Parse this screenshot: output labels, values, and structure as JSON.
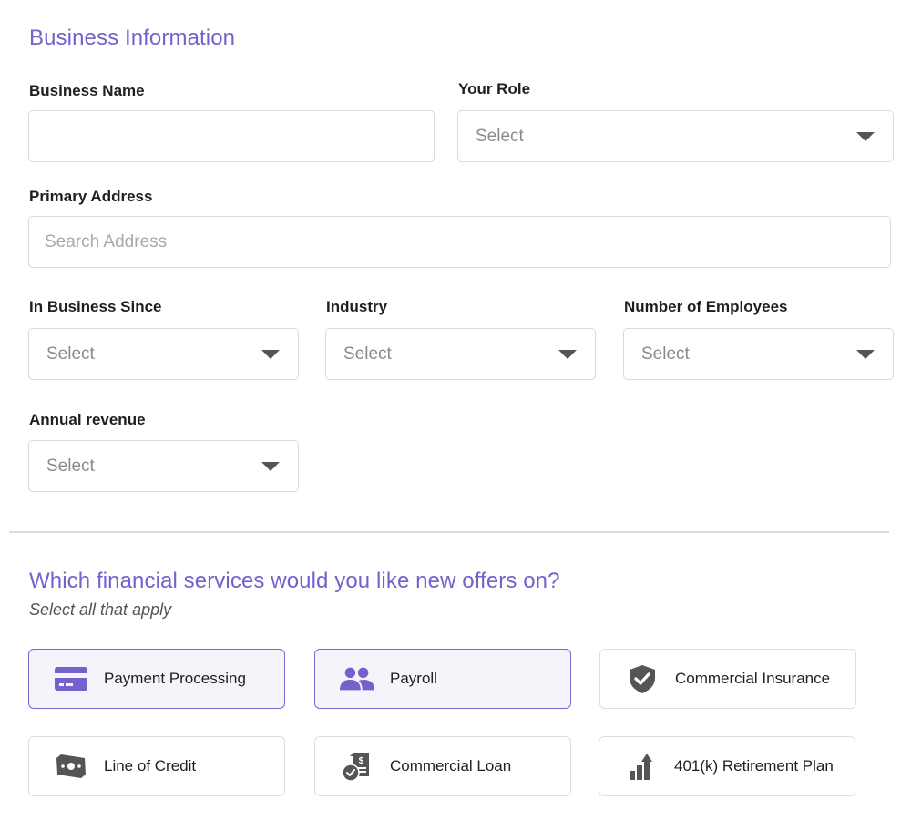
{
  "business_info": {
    "title": "Business Information",
    "business_name": {
      "label": "Business Name",
      "value": ""
    },
    "your_role": {
      "label": "Your Role",
      "value": "Select"
    },
    "primary_address": {
      "label": "Primary Address",
      "placeholder": "Search Address",
      "value": ""
    },
    "in_business_since": {
      "label": "In Business Since",
      "value": "Select"
    },
    "industry": {
      "label": "Industry",
      "value": "Select"
    },
    "number_of_employees": {
      "label": "Number of Employees",
      "value": "Select"
    },
    "annual_revenue": {
      "label": "Annual revenue",
      "value": "Select"
    }
  },
  "services": {
    "title": "Which financial services would you like new offers on?",
    "subtitle": "Select all that apply",
    "options": [
      {
        "label": "Payment Processing",
        "icon": "credit-card-icon",
        "selected": true
      },
      {
        "label": "Payroll",
        "icon": "people-icon",
        "selected": true
      },
      {
        "label": "Commercial Insurance",
        "icon": "shield-check-icon",
        "selected": false
      },
      {
        "label": "Line of Credit",
        "icon": "money-bill-icon",
        "selected": false
      },
      {
        "label": "Commercial Loan",
        "icon": "loan-document-icon",
        "selected": false
      },
      {
        "label": "401(k) Retirement Plan",
        "icon": "growth-chart-icon",
        "selected": false
      }
    ]
  },
  "colors": {
    "accent": "#7661cc",
    "selected_bg": "#f5f4fb",
    "selected_border": "#7a68cf",
    "icon_gray": "#555555"
  }
}
